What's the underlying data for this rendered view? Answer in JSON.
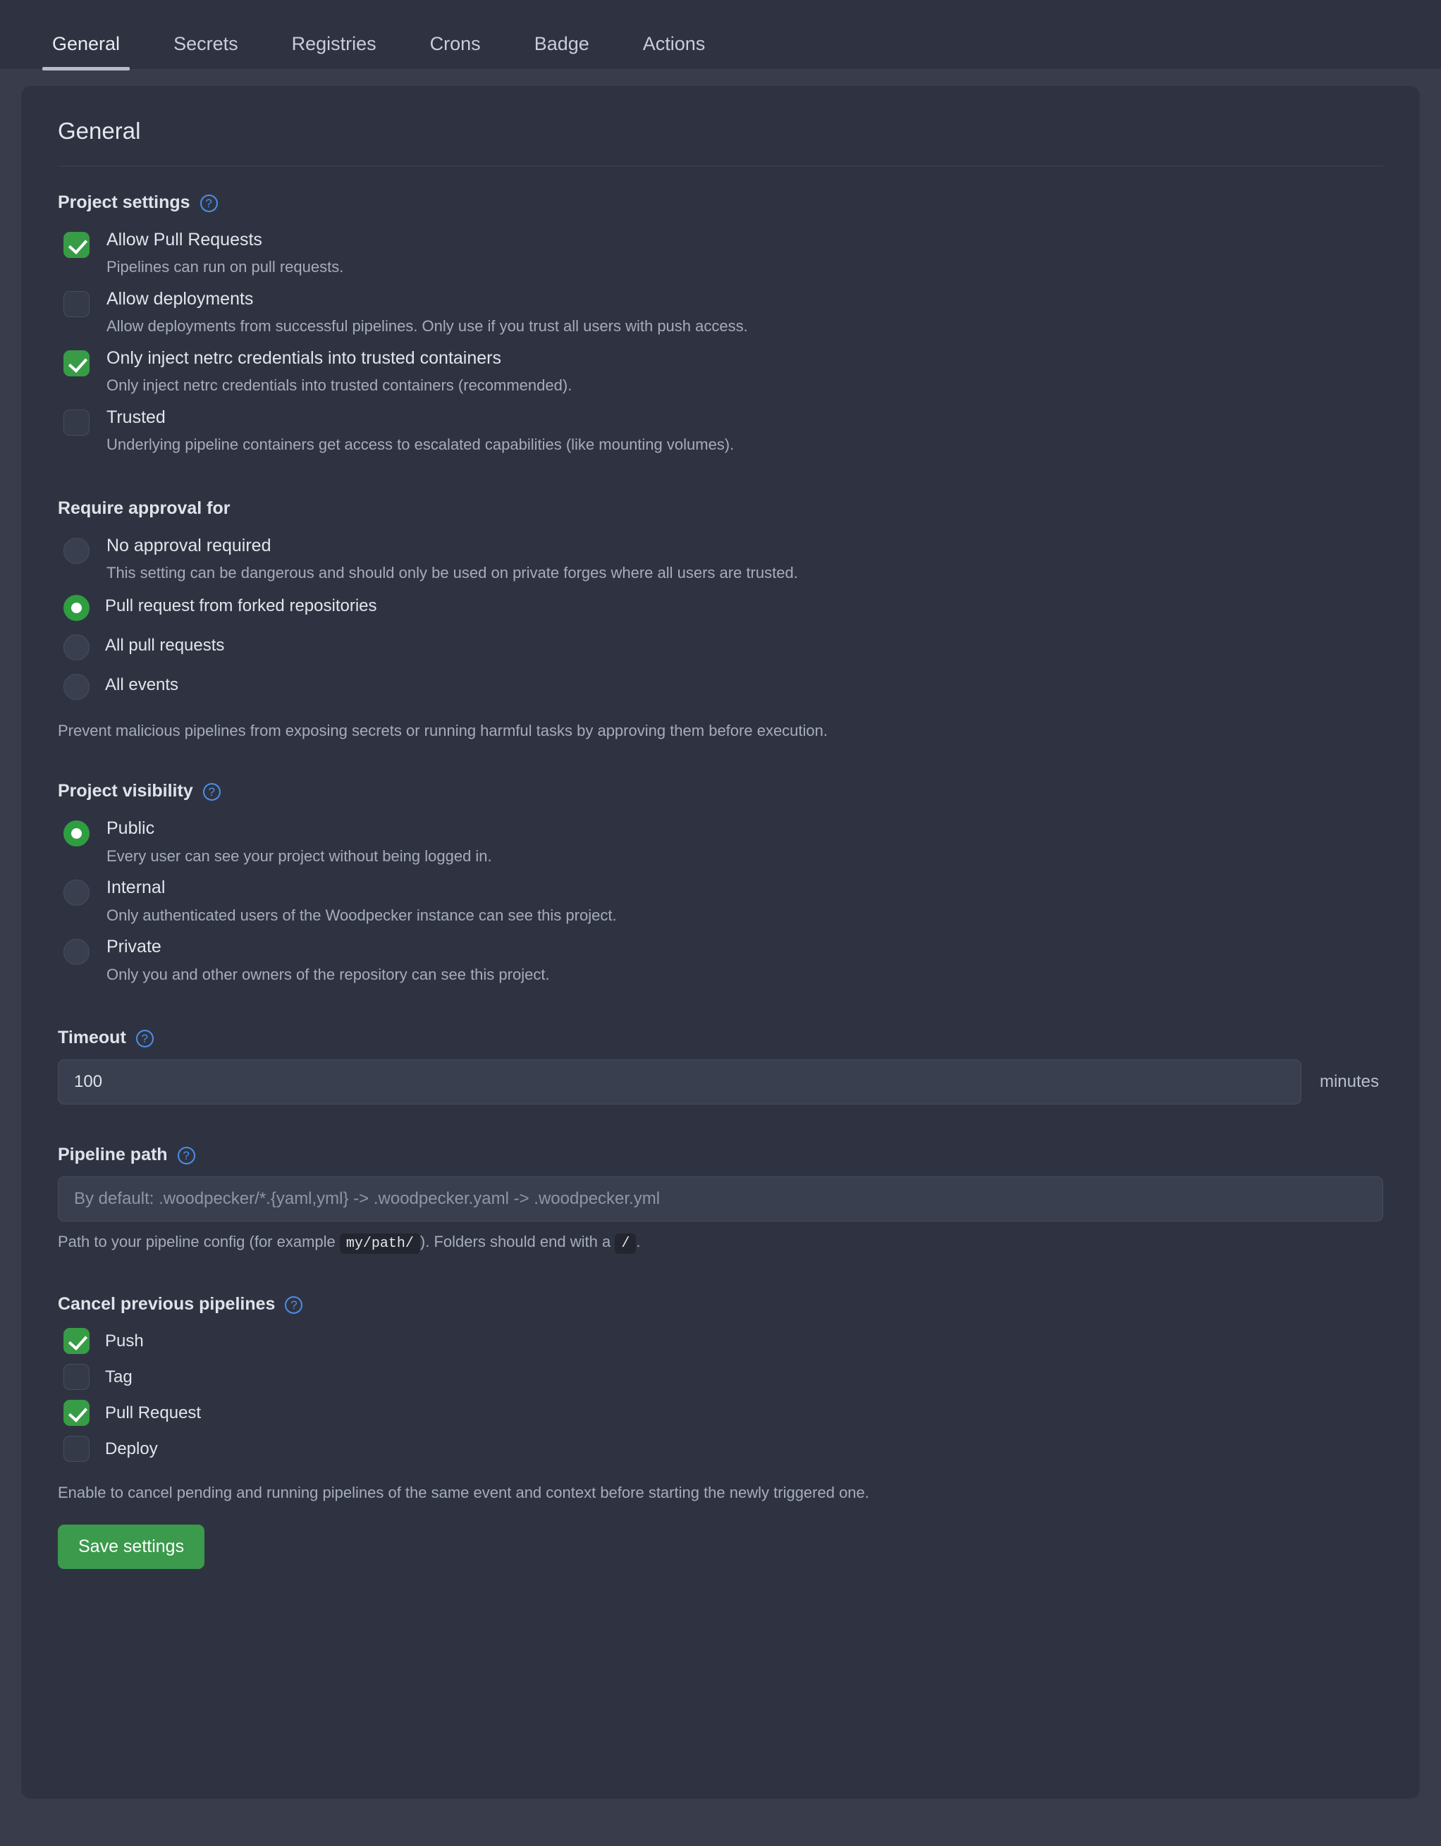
{
  "tabs": [
    {
      "label": "General",
      "active": true
    },
    {
      "label": "Secrets",
      "active": false
    },
    {
      "label": "Registries",
      "active": false
    },
    {
      "label": "Crons",
      "active": false
    },
    {
      "label": "Badge",
      "active": false
    },
    {
      "label": "Actions",
      "active": false
    }
  ],
  "card": {
    "title": "General"
  },
  "project_settings": {
    "heading": "Project settings",
    "help_icon": "question-mark-icon",
    "options": [
      {
        "label": "Allow Pull Requests",
        "desc": "Pipelines can run on pull requests.",
        "checked": true
      },
      {
        "label": "Allow deployments",
        "desc": "Allow deployments from successful pipelines. Only use if you trust all users with push access.",
        "checked": false
      },
      {
        "label": "Only inject netrc credentials into trusted containers",
        "desc": "Only inject netrc credentials into trusted containers (recommended).",
        "checked": true
      },
      {
        "label": "Trusted",
        "desc": "Underlying pipeline containers get access to escalated capabilities (like mounting volumes).",
        "checked": false
      }
    ]
  },
  "require_approval": {
    "heading": "Require approval for",
    "options": [
      {
        "label": "No approval required",
        "desc": "This setting can be dangerous and should only be used on private forges where all users are trusted.",
        "selected": false
      },
      {
        "label": "Pull request from forked repositories",
        "desc": "",
        "selected": true
      },
      {
        "label": "All pull requests",
        "desc": "",
        "selected": false
      },
      {
        "label": "All events",
        "desc": "",
        "selected": false
      }
    ],
    "note": "Prevent malicious pipelines from exposing secrets or running harmful tasks by approving them before execution."
  },
  "project_visibility": {
    "heading": "Project visibility",
    "help_icon": "question-mark-icon",
    "options": [
      {
        "label": "Public",
        "desc": "Every user can see your project without being logged in.",
        "selected": true
      },
      {
        "label": "Internal",
        "desc": "Only authenticated users of the Woodpecker instance can see this project.",
        "selected": false
      },
      {
        "label": "Private",
        "desc": "Only you and other owners of the repository can see this project.",
        "selected": false
      }
    ]
  },
  "timeout": {
    "heading": "Timeout",
    "help_icon": "question-mark-icon",
    "value": "100",
    "unit": "minutes"
  },
  "pipeline_path": {
    "heading": "Pipeline path",
    "help_icon": "question-mark-icon",
    "value": "",
    "placeholder": "By default: .woodpecker/*.{yaml,yml} -> .woodpecker.yaml -> .woodpecker.yml",
    "hint_before": "Path to your pipeline config (for example",
    "hint_code_1": "my/path/",
    "hint_middle": "). Folders should end with a",
    "hint_code_2": "/",
    "hint_after": "."
  },
  "cancel_previous": {
    "heading": "Cancel previous pipelines",
    "help_icon": "question-mark-icon",
    "options": [
      {
        "label": "Push",
        "checked": true
      },
      {
        "label": "Tag",
        "checked": false
      },
      {
        "label": "Pull Request",
        "checked": true
      },
      {
        "label": "Deploy",
        "checked": false
      }
    ],
    "note": "Enable to cancel pending and running pipelines of the same event and context before starting the newly triggered one."
  },
  "actions": {
    "save_label": "Save settings"
  },
  "colors": {
    "page_bg": "#383c4b",
    "card_bg": "#2f3341",
    "accent_green": "#389c46",
    "help_blue": "#4c8ee8",
    "text_primary": "#e2e5ec",
    "text_secondary": "#a5acbb"
  }
}
